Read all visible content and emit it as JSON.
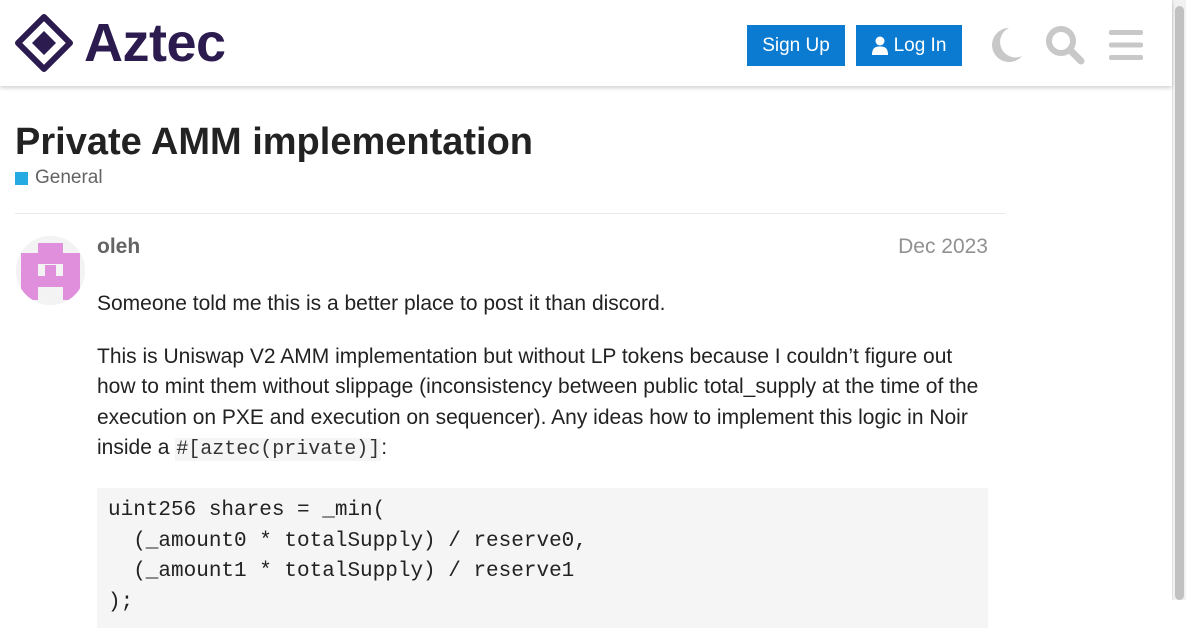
{
  "header": {
    "logo_text": "Aztec",
    "signup_label": "Sign Up",
    "login_label": "Log In",
    "icons": [
      "moon-icon",
      "search-icon",
      "hamburger-menu-icon"
    ],
    "colors": {
      "logo": "#2b1b4f",
      "button": "#0a7bd0",
      "icon_gray": "#c8c8c8"
    }
  },
  "topic": {
    "title": "Private AMM implementation",
    "category": "General",
    "category_color": "#25aae1"
  },
  "post": {
    "username": "oleh",
    "date": "Dec 2023",
    "avatar_color": "#e08fdd",
    "paragraph1": "Someone told me this is a better place to post it than discord.",
    "paragraph2_text": "This is Uniswap V2 AMM implementation but without LP tokens because I couldn’t figure out how to mint them without slippage (inconsistency between public total_supply at the time of the execution on PXE and execution on sequencer). Any ideas how to implement this logic in Noir inside a ",
    "paragraph2_code": "#[aztec(private)]",
    "paragraph2_end": ":",
    "code_lines": [
      "uint256 shares = _min(",
      "  (_amount0 * totalSupply) / reserve0,",
      "  (_amount1 * totalSupply) / reserve1",
      ");"
    ]
  }
}
